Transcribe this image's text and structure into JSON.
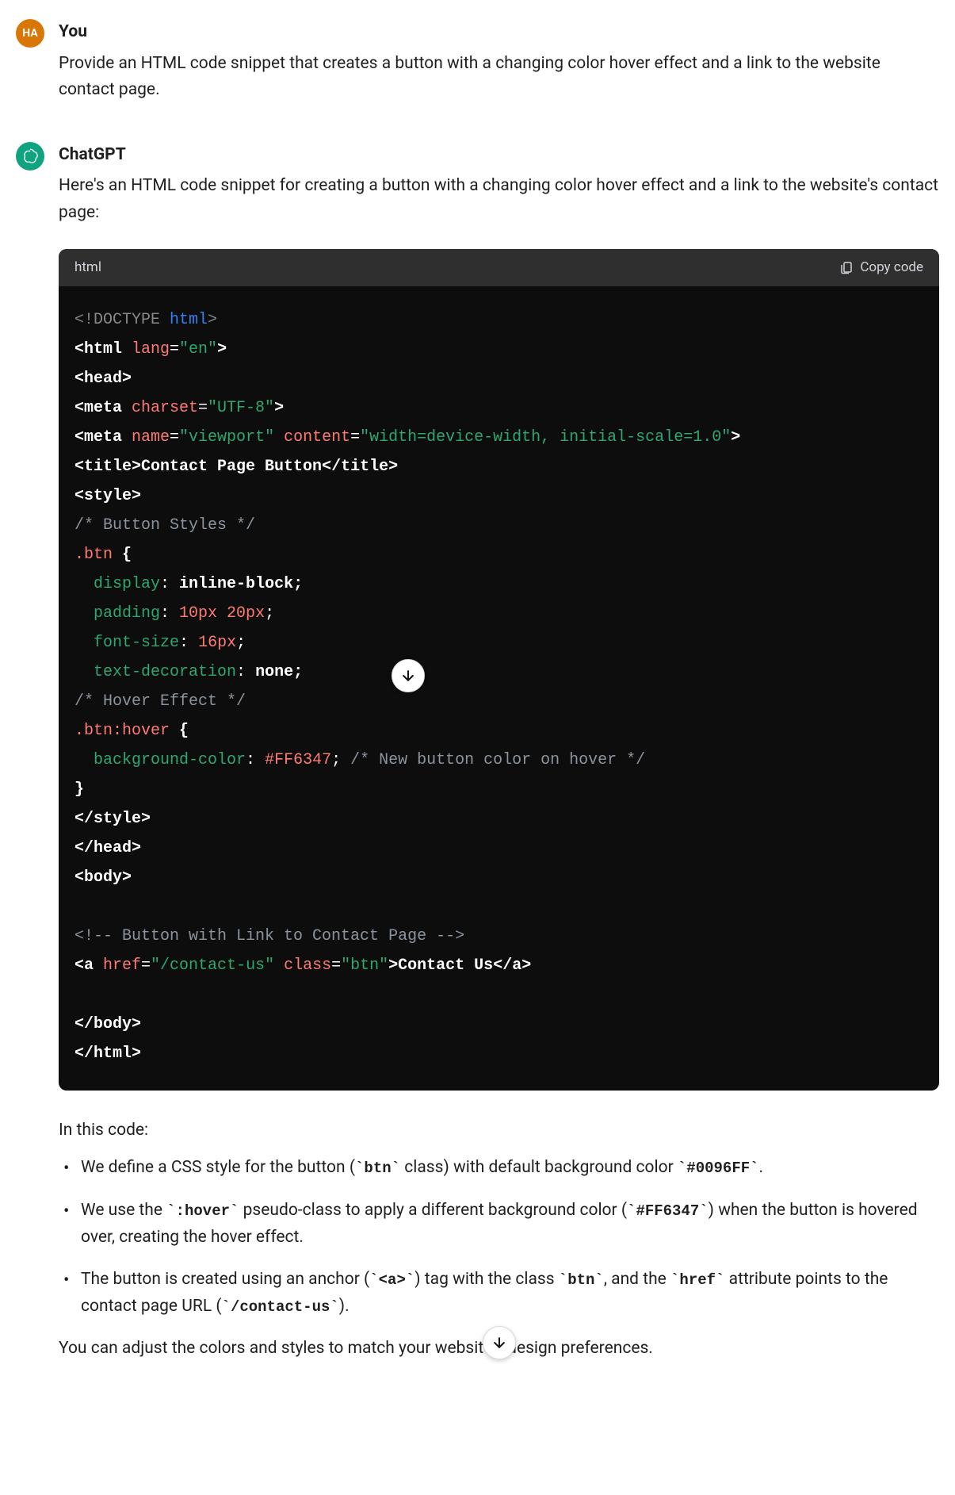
{
  "user": {
    "avatar_text": "HA",
    "sender": "You",
    "message": "Provide an HTML code snippet that creates a button with a changing color hover effect and a link to the website contact page."
  },
  "bot": {
    "sender": "ChatGPT",
    "intro": "Here's an HTML code snippet for creating a button with a changing color hover effect and a link to the website's contact page:",
    "code_lang": "html",
    "copy_label": "Copy code",
    "explain_intro": "In this code:",
    "bullets": {
      "b1a": "We define a CSS style for the button (",
      "b1b": " class) with default background color ",
      "b1c": ".",
      "b1_code1": "`btn`",
      "b1_code2": "`#0096FF`",
      "b2a": "We use the ",
      "b2b": " pseudo-class to apply a different background color (",
      "b2c": ") when the button is hovered over, creating the hover effect.",
      "b2_code1": "`:hover`",
      "b2_code2": "`#FF6347`",
      "b3a": "The button is created using an anchor (",
      "b3b": ") tag with the class ",
      "b3c": ", and the ",
      "b3d": " attribute points to the contact page URL (",
      "b3e": ").",
      "b3_code1": "`<a>`",
      "b3_code2": "`btn`",
      "b3_code3": "`href`",
      "b3_code4": "`/contact-us`"
    },
    "outro": "You can adjust the colors and styles to match your website's design preferences."
  },
  "code": {
    "l1_a": "<!DOCTYPE ",
    "l1_b": "html",
    "l1_c": ">",
    "l2_a": "<html ",
    "l2_b": "lang",
    "l2_c": "=",
    "l2_d": "\"en\"",
    "l2_e": ">",
    "l3": "<head>",
    "l4_a": "<meta ",
    "l4_b": "charset",
    "l4_c": "=",
    "l4_d": "\"UTF-8\"",
    "l4_e": ">",
    "l5_a": "<meta ",
    "l5_b": "name",
    "l5_c": "=",
    "l5_d": "\"viewport\"",
    "l5_e": " ",
    "l5_f": "content",
    "l5_g": "=",
    "l5_h": "\"width=device-width, initial-scale=1.0\"",
    "l5_i": ">",
    "l6_a": "<title>",
    "l6_b": "Contact Page Button",
    "l6_c": "</title>",
    "l7": "<style>",
    "l8": "/* Button Styles */",
    "l9_a": ".btn",
    "l9_b": " {",
    "l10_a": "  ",
    "l10_b": "display",
    "l10_c": ": ",
    "l10_d": "inline-block;",
    "l11_a": "  ",
    "l11_b": "padding",
    "l11_c": ": ",
    "l11_d": "10px 20px",
    "l11_e": ";",
    "l12_a": "  ",
    "l12_b": "font-size",
    "l12_c": ": ",
    "l12_d": "16px",
    "l12_e": ";",
    "l13_a": "  ",
    "l13_b": "text-decoration",
    "l13_c": ": ",
    "l13_d": "none;",
    "l14": "/* Hover Effect */",
    "l15_a": ".btn:hover",
    "l15_b": " {",
    "l16_a": "  ",
    "l16_b": "background-color",
    "l16_c": ": ",
    "l16_d": "#FF6347",
    "l16_e": ";",
    "l16_f": " /* New button color on hover */",
    "l17": "}",
    "l18": "</style>",
    "l19": "</head>",
    "l20": "<body>",
    "l21": "<!-- Button with Link to Contact Page -->",
    "l22_a": "<a ",
    "l22_b": "href",
    "l22_c": "=",
    "l22_d": "\"/contact-us\"",
    "l22_e": " ",
    "l22_f": "class",
    "l22_g": "=",
    "l22_h": "\"btn\"",
    "l22_i": ">",
    "l22_j": "Contact Us",
    "l22_k": "</a>",
    "l23": "</body>",
    "l24": "</html>"
  }
}
